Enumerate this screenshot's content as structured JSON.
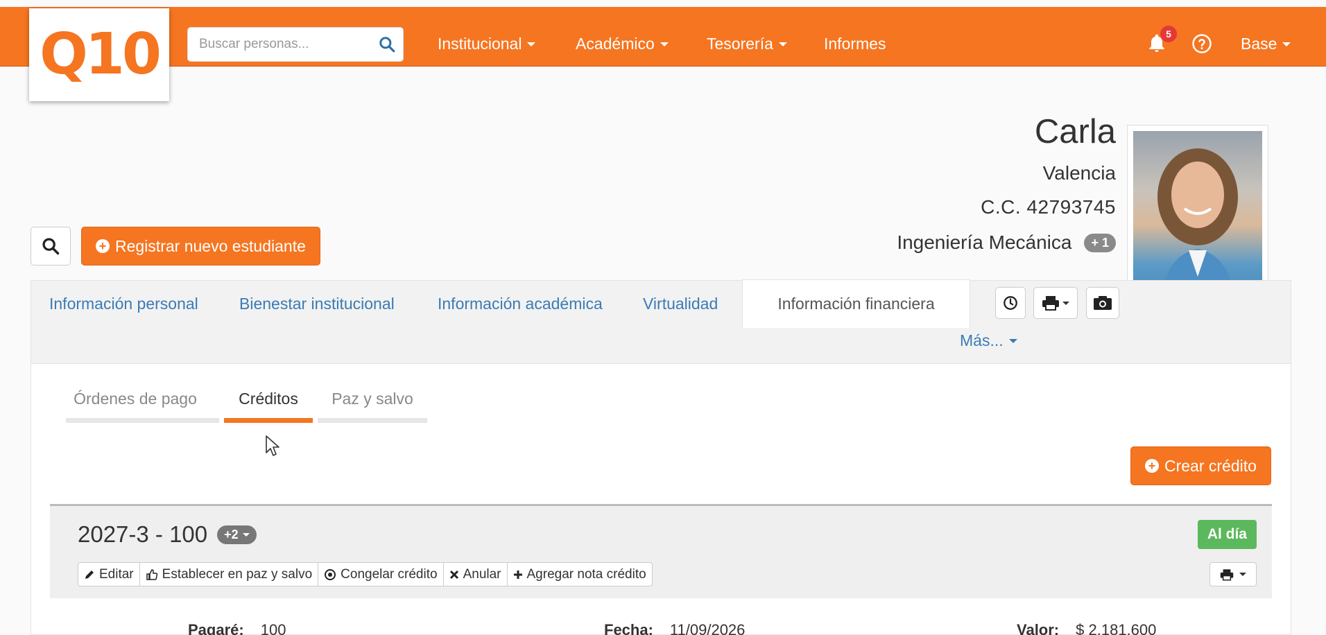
{
  "header": {
    "logo_text": "Q10",
    "search_placeholder": "Buscar personas...",
    "nav": [
      {
        "label": "Institucional",
        "has_caret": true
      },
      {
        "label": "Académico",
        "has_caret": true
      },
      {
        "label": "Tesorería",
        "has_caret": true
      },
      {
        "label": "Informes",
        "has_caret": false
      }
    ],
    "notification_count": "5",
    "user_menu": "Base"
  },
  "profile": {
    "name": "Carla",
    "city": "Valencia",
    "document": "C.C. 42793745",
    "program": "Ingeniería Mecánica",
    "program_extra": "+ 1"
  },
  "actions": {
    "register_label": "Registrar nuevo estudiante"
  },
  "tabs": {
    "items": [
      "Información personal",
      "Bienestar institucional",
      "Información académica",
      "Virtualidad"
    ],
    "active": "Información financiera",
    "more": "Más..."
  },
  "subtabs": {
    "items": [
      "Órdenes de pago",
      "Créditos",
      "Paz y salvo"
    ],
    "active_index": 1
  },
  "credit_button": "Crear crédito",
  "credit": {
    "title": "2027-3 - 100",
    "extra": "+2",
    "status": "Al día",
    "actions": [
      "Editar",
      "Establecer en paz y salvo",
      "Congelar crédito",
      "Anular",
      "Agregar nota crédito"
    ],
    "details": [
      {
        "label": "Pagaré:",
        "value": "100"
      },
      {
        "label": "Fecha:",
        "value": "11/09/2026"
      },
      {
        "label": "Valor:",
        "value": "$ 2.181.600"
      }
    ]
  },
  "colors": {
    "brand": "#f57521",
    "link": "#3a7bb5",
    "success": "#5cb85c"
  }
}
